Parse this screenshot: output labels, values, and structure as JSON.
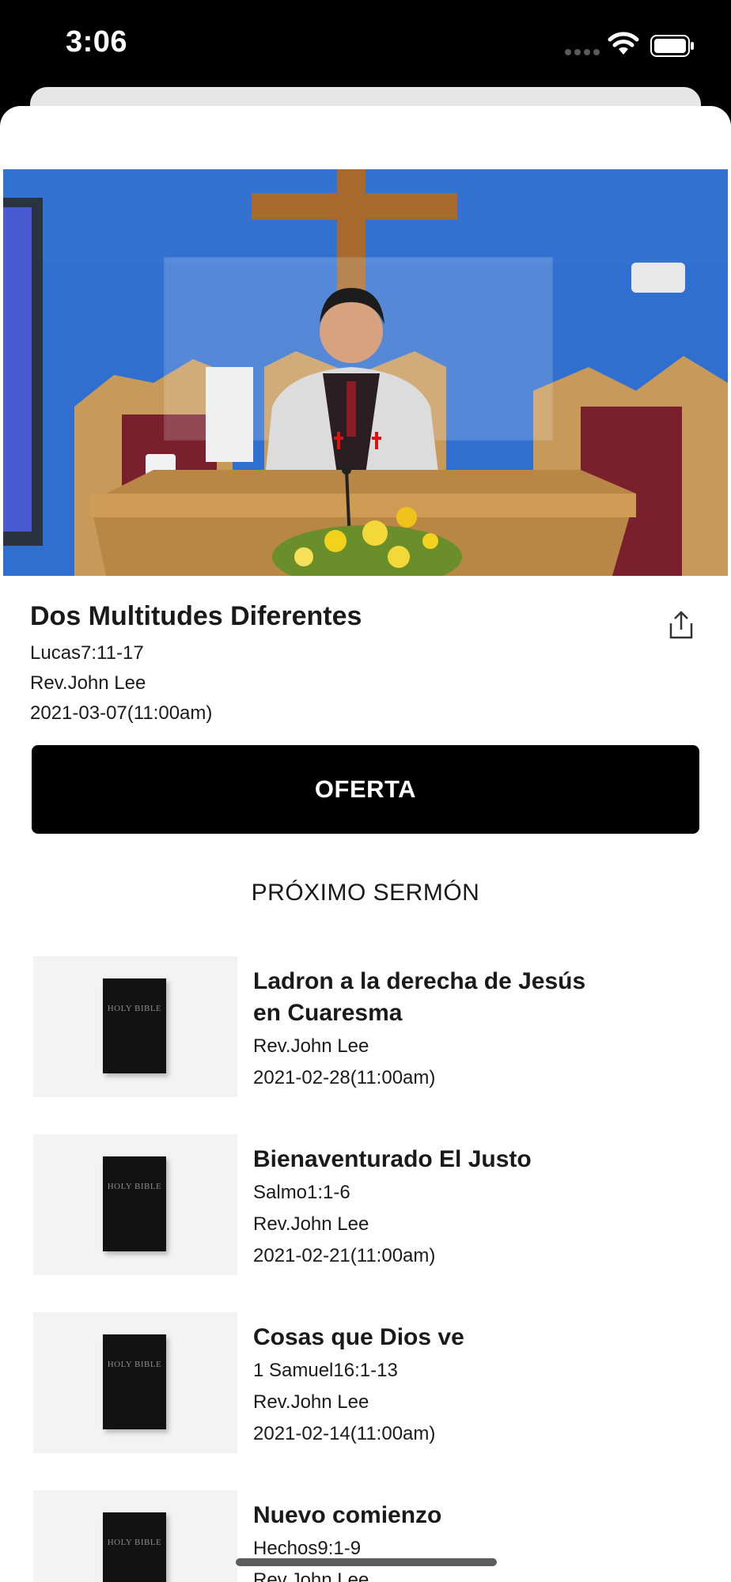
{
  "status_bar": {
    "time": "3:06"
  },
  "sermon": {
    "title": "Dos Multitudes Diferentes",
    "passage": "Lucas7:11-17",
    "preacher": "Rev.John Lee",
    "date": "2021-03-07(11:00am)"
  },
  "offer_button": {
    "label": "OFERTA"
  },
  "next_section": {
    "heading": "PRÓXIMO SERMÓN"
  },
  "thumbnail_text": "HOLY BIBLE",
  "next_sermons": [
    {
      "title": "Ladron a la derecha de Jesús en Cuaresma",
      "preacher": "Rev.John Lee",
      "date": "2021-02-28(11:00am)"
    },
    {
      "title": "Bienaventurado El Justo",
      "passage": "Salmo1:1-6",
      "preacher": "Rev.John Lee",
      "date": "2021-02-21(11:00am)"
    },
    {
      "title": "Cosas que Dios ve",
      "passage": "1 Samuel16:1-13",
      "preacher": "Rev.John Lee",
      "date": "2021-02-14(11:00am)"
    },
    {
      "title": "Nuevo comienzo",
      "passage": "Hechos9:1-9",
      "preacher": "Rev.John Lee"
    }
  ],
  "icons": {
    "share": "share-icon",
    "wifi": "wifi-icon",
    "battery": "battery-icon",
    "signal": "cellular-signal-icon"
  }
}
